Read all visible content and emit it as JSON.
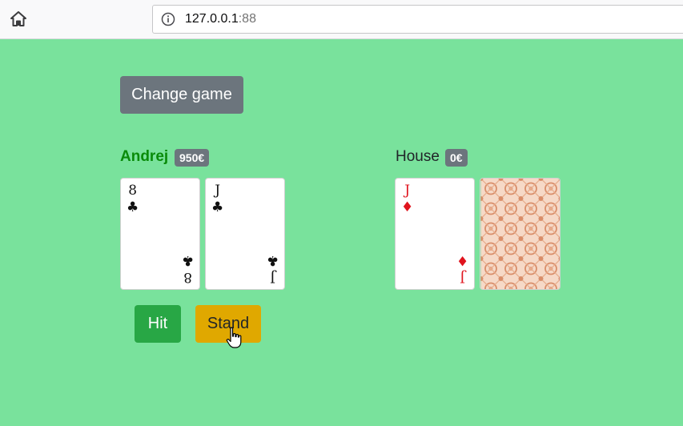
{
  "browser": {
    "url_host": "127.0.0.1",
    "url_port": ":88",
    "icons": {
      "home": "home-icon",
      "info": "info-icon"
    }
  },
  "game": {
    "change_game_label": "Change game",
    "hit_label": "Hit",
    "stand_label": "Stand"
  },
  "player": {
    "name": "Andrej",
    "balance": "950€",
    "name_color": "#098b09",
    "cards": [
      {
        "rank": "8",
        "suit": "♣",
        "color": "black"
      },
      {
        "rank": "J",
        "suit": "♣",
        "color": "black"
      }
    ]
  },
  "house": {
    "name": "House",
    "balance": "0€",
    "cards": [
      {
        "rank": "J",
        "suit": "♦",
        "color": "red"
      },
      {
        "face_down": true
      }
    ]
  },
  "colors": {
    "table": "#79e29c",
    "secondary": "#6c757d",
    "success": "#28a745",
    "warning": "#e0a800"
  }
}
